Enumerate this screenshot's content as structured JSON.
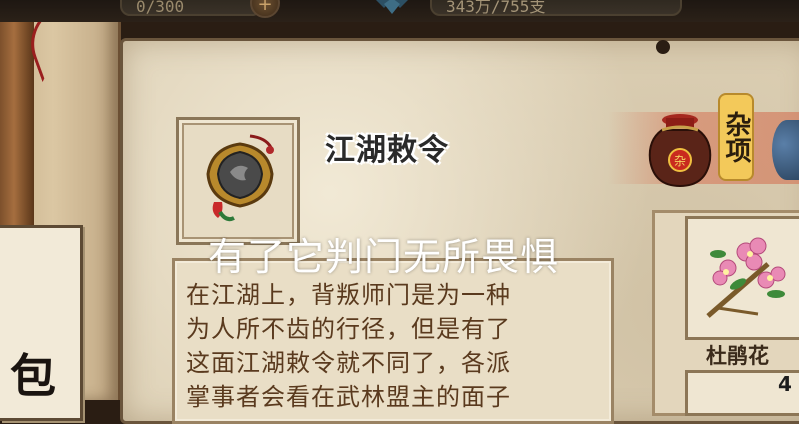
{
  "top_bar": {
    "left_counter": "0/300",
    "right_counter": "343万/755支",
    "add_label": "+"
  },
  "side_scroll": {
    "label_char": "包"
  },
  "item": {
    "name": "江湖敕令",
    "overlay_caption": "有了它判门无所畏惧",
    "description_lines": [
      "在江湖上，背叛师门是为一种",
      "为人所不齿的行径，但是有了",
      "这面江湖敕令就不同了，各派",
      "掌事者会看在武林盟主的面子"
    ]
  },
  "category": {
    "label": "杂项",
    "jar_char": "杂"
  },
  "inventory": {
    "first_item_name": "杜鹃花",
    "second_item_count": "4"
  },
  "colors": {
    "parchment": "#ddd0b5",
    "desc_text": "#5a3a1e",
    "category_tag": "#f3c95a"
  }
}
